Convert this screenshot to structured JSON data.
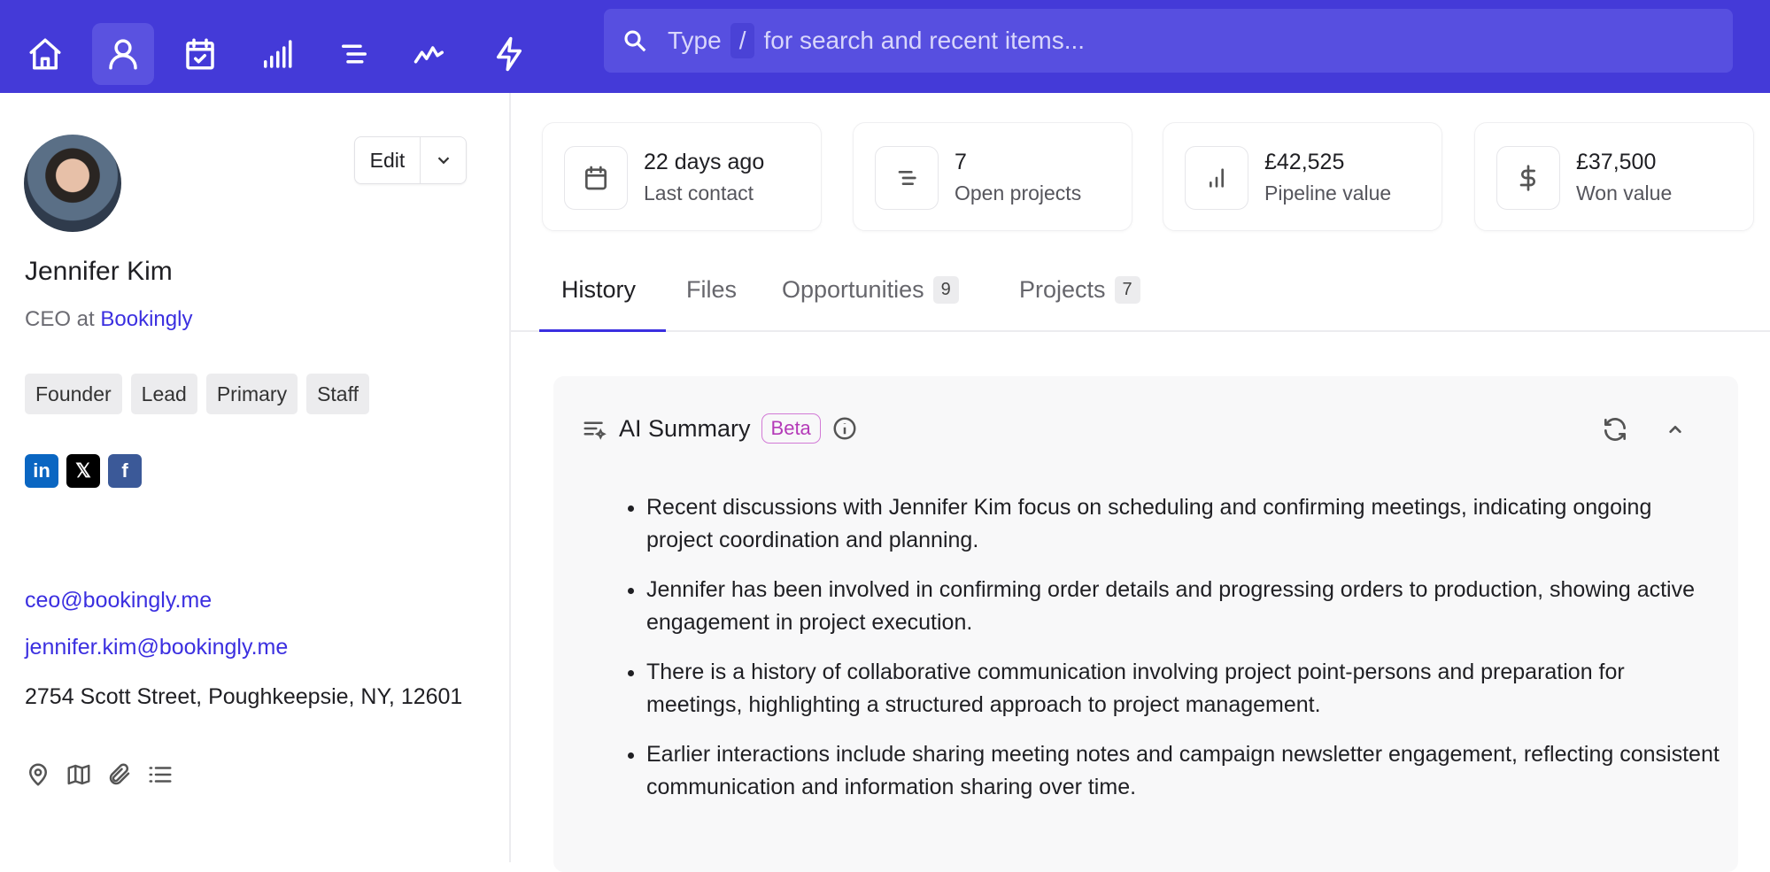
{
  "topbar": {
    "nav": [
      "home-icon",
      "user-icon",
      "calendar-check-icon",
      "signal-bars-icon",
      "list-icon",
      "activity-icon",
      "lightning-icon"
    ],
    "search": {
      "prefix": "Type",
      "key": "/",
      "suffix": "for search and recent items..."
    }
  },
  "contact": {
    "edit_label": "Edit",
    "name": "Jennifer Kim",
    "role_prefix": "CEO at",
    "company": "Bookingly",
    "tags": [
      "Founder",
      "Lead",
      "Primary",
      "Staff"
    ],
    "social": {
      "linkedin": "in",
      "x": "𝕏",
      "facebook": "f"
    },
    "emails": [
      "ceo@bookingly.me",
      "jennifer.kim@bookingly.me"
    ],
    "address": "2754 Scott Street, Poughkeepsie, NY, 12601"
  },
  "stats": [
    {
      "value": "22 days ago",
      "label": "Last contact"
    },
    {
      "value": "7",
      "label": "Open projects"
    },
    {
      "value": "£42,525",
      "label": "Pipeline value"
    },
    {
      "value": "£37,500",
      "label": "Won value"
    }
  ],
  "tabs": [
    {
      "label": "History"
    },
    {
      "label": "Files"
    },
    {
      "label": "Opportunities",
      "count": "9"
    },
    {
      "label": "Projects",
      "count": "7"
    }
  ],
  "summary": {
    "title": "AI Summary",
    "badge": "Beta",
    "bullets": [
      "Recent discussions with Jennifer Kim focus on scheduling and confirming meetings, indicating ongoing project coordination and planning.",
      "Jennifer has been involved in confirming order details and progressing orders to production, showing active engagement in project execution.",
      "There is a history of collaborative communication involving project point-persons and preparation for meetings, highlighting a structured approach to project management.",
      "Earlier interactions include sharing meeting notes and campaign newsletter engagement, reflecting consistent communication and information sharing over time."
    ]
  }
}
